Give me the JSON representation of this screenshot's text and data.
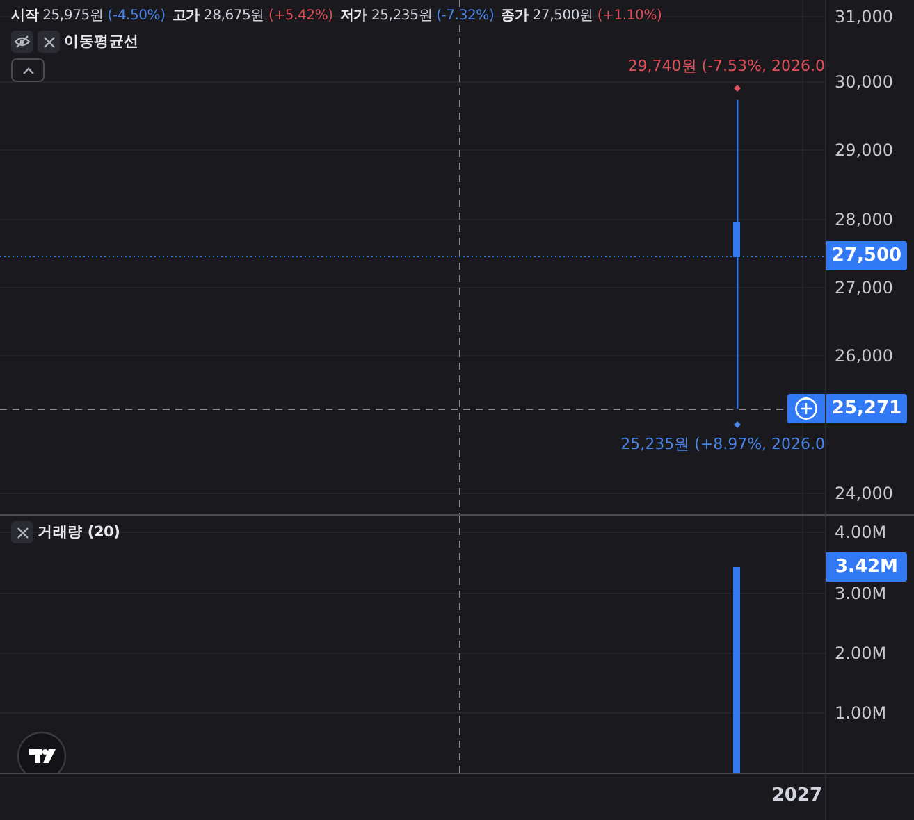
{
  "legend": {
    "items": [
      {
        "label": "시작",
        "value": "25,975원",
        "change": "(-4.50%)",
        "color": "#4a86e8"
      },
      {
        "label": "고가",
        "value": "28,675원",
        "change": "(+5.42%)",
        "color": "#e0505a"
      },
      {
        "label": "저가",
        "value": "25,235원",
        "change": "(-7.32%)",
        "color": "#4a86e8"
      },
      {
        "label": "종가",
        "value": "27,500원",
        "change": "(+1.10%)",
        "color": "#e0505a"
      }
    ]
  },
  "indicator": {
    "name": "이동평균선",
    "visible": false
  },
  "price_pane": {
    "axis_labels": [
      "31,000",
      "30,000",
      "29,000",
      "28,000",
      "27,000",
      "26,000",
      "24,000"
    ],
    "high_label": "29,740원 (-7.53%, 2026.0",
    "low_label": "25,235원 (+8.97%, 2026.0",
    "last_price": "27,500",
    "crosshair_price": "25,271"
  },
  "volume_pane": {
    "title": "거래량 (20)",
    "axis_labels": [
      "4.00M",
      "3.00M",
      "2.00M",
      "1.00M"
    ],
    "last_volume": "3.42M"
  },
  "time_axis": {
    "labels": [
      "2027"
    ]
  }
}
